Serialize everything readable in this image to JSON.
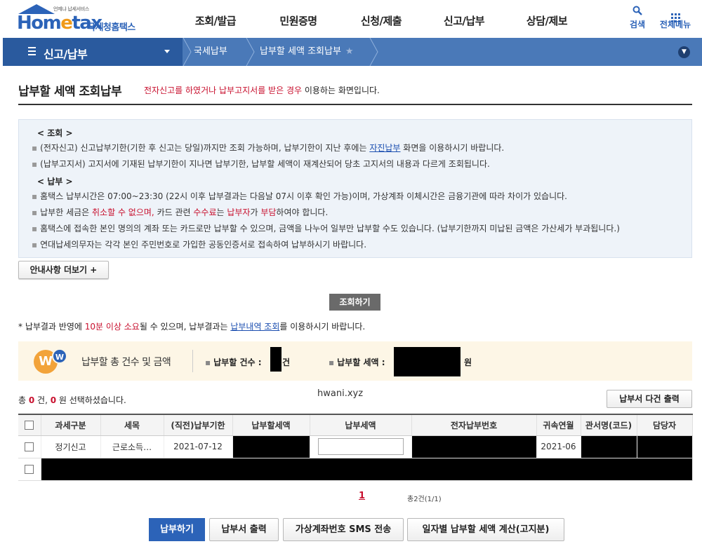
{
  "brand": {
    "tagline": "언제냐 납세서비스",
    "logo_text": "Hometax",
    "korean_name": "국세청홈택스"
  },
  "gnb": [
    "조회/발급",
    "민원증명",
    "신청/제출",
    "신고/납부",
    "상담/제보"
  ],
  "top_buttons": {
    "search": "검색",
    "all_menu": "전체메뉴"
  },
  "location": {
    "menu": "신고/납부",
    "crumb1": "국세납부",
    "crumb2": "납부할 세액 조회납부"
  },
  "page": {
    "title": "납부할 세액 조회납부",
    "subtitle_red": "전자신고를 하였거나 납부고지서를 받은 경우",
    "subtitle_rest": " 이용하는 화면입니다."
  },
  "info": {
    "head_inquiry": "< 조회 >",
    "inq_line1_a": "(전자신고) 신고납부기한(기한 후 신고는 당일)까지만 조회 가능하며, 납부기한이 지난 후에는 ",
    "inq_line1_link": "자진납부",
    "inq_line1_b": " 화면을 이용하시기 바랍니다.",
    "inq_line2": "(납부고지서) 고지서에 기재된 납부기한이 지나면 납부기한, 납부할 세액이 재계산되어 당초 고지서의 내용과 다르게 조회됩니다.",
    "head_payment": "< 납부 >",
    "pay_line1": "홈택스 납부시간은 07:00~23:30 (22시 이후 납부결과는 다음날 07시 이후 확인 가능)이며, 가상계좌 이체시간은 금융기관에 따라 차이가 있습니다.",
    "pay_line2_a": "납부한 세금은 ",
    "pay_line2_red1": "취소할 수 없으며,",
    "pay_line2_b": " 카드 관련 ",
    "pay_line2_red2": "수수료",
    "pay_line2_c": "는 ",
    "pay_line2_red3": "납부자",
    "pay_line2_d": "가 ",
    "pay_line2_red4": "부담",
    "pay_line2_e": "하여야 합니다.",
    "pay_line3": "홈택스에 접속한 본인 명의의 계좌 또는 카드로만 납부할 수 있으며, 금액을 나누어 일부만 납부할 수도 있습니다. (납부기한까지 미납된 금액은 가산세가 부과됩니다.)",
    "pay_line4": "연대납세의무자는 각각 본인 주민번호로 가입한 공동인증서로 접속하여 납부하시기 바랍니다."
  },
  "buttons": {
    "more": "안내사항 더보기 +",
    "inquire": "조회하기",
    "multi_print": "납부서 다건 출력",
    "pay": "납부하기",
    "print": "납부서 출력",
    "sms": "가상계좌번호 SMS 전송",
    "daily_calc": "일자별 납부할 세액 계산(고지분)"
  },
  "notice": {
    "a": "* 납부결과 반영에 ",
    "red": "10분 이상 소요",
    "b": "될 수 있으며, 납부결과는 ",
    "link": "납부내역 조회",
    "c": "를 이용하시기 바랍니다."
  },
  "summary": {
    "title": "납부할 총 건수 및 금액",
    "count_label": "납부할 건수 :",
    "count_unit": "건",
    "amount_label": "납부할 세액 :",
    "amount_unit": "원"
  },
  "selection": {
    "prefix": "총 ",
    "count": "0",
    "mid": " 건, ",
    "amount": "0",
    "suffix": " 원 선택하셨습니다."
  },
  "watermark": "hwani.xyz",
  "table": {
    "headers": [
      "과세구분",
      "세목",
      "(직전)납부기한",
      "납부할세액",
      "납부세액",
      "전자납부번호",
      "귀속연월",
      "관서명(코드)",
      "담당자"
    ],
    "rows": [
      {
        "category": "정기신고",
        "tax_item": "근로소득…",
        "due_date": "2021-07-12",
        "period": "2021-06"
      }
    ]
  },
  "pagination": {
    "page": "1",
    "total": "총2건(1/1)"
  }
}
